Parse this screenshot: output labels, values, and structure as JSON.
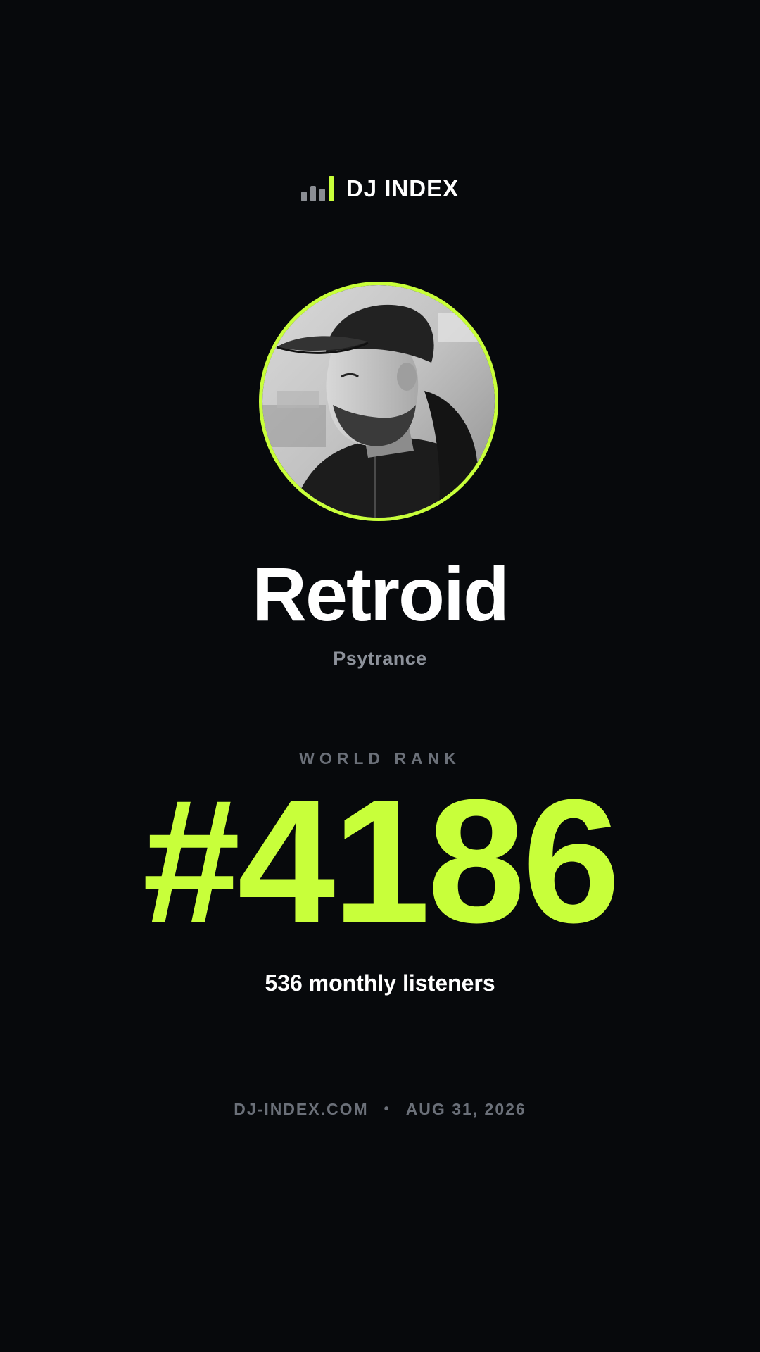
{
  "brand": {
    "name": "DJ INDEX",
    "logo_icon": "bar-chart-icon",
    "accent_color": "#c8ff3a",
    "muted_bar_color": "#8a8d93"
  },
  "artist": {
    "photo_icon": "artist-photo",
    "name": "Retroid",
    "genre": "Psytrance"
  },
  "rank": {
    "label": "WORLD RANK",
    "value": "#4186",
    "listeners": "536 monthly listeners"
  },
  "footer": {
    "site": "DJ-INDEX.COM",
    "separator": "•",
    "date": "AUG 31, 2026"
  },
  "colors": {
    "background": "#07090c",
    "accent": "#c8ff3a",
    "text_primary": "#ffffff",
    "text_muted": "#8d929b"
  }
}
